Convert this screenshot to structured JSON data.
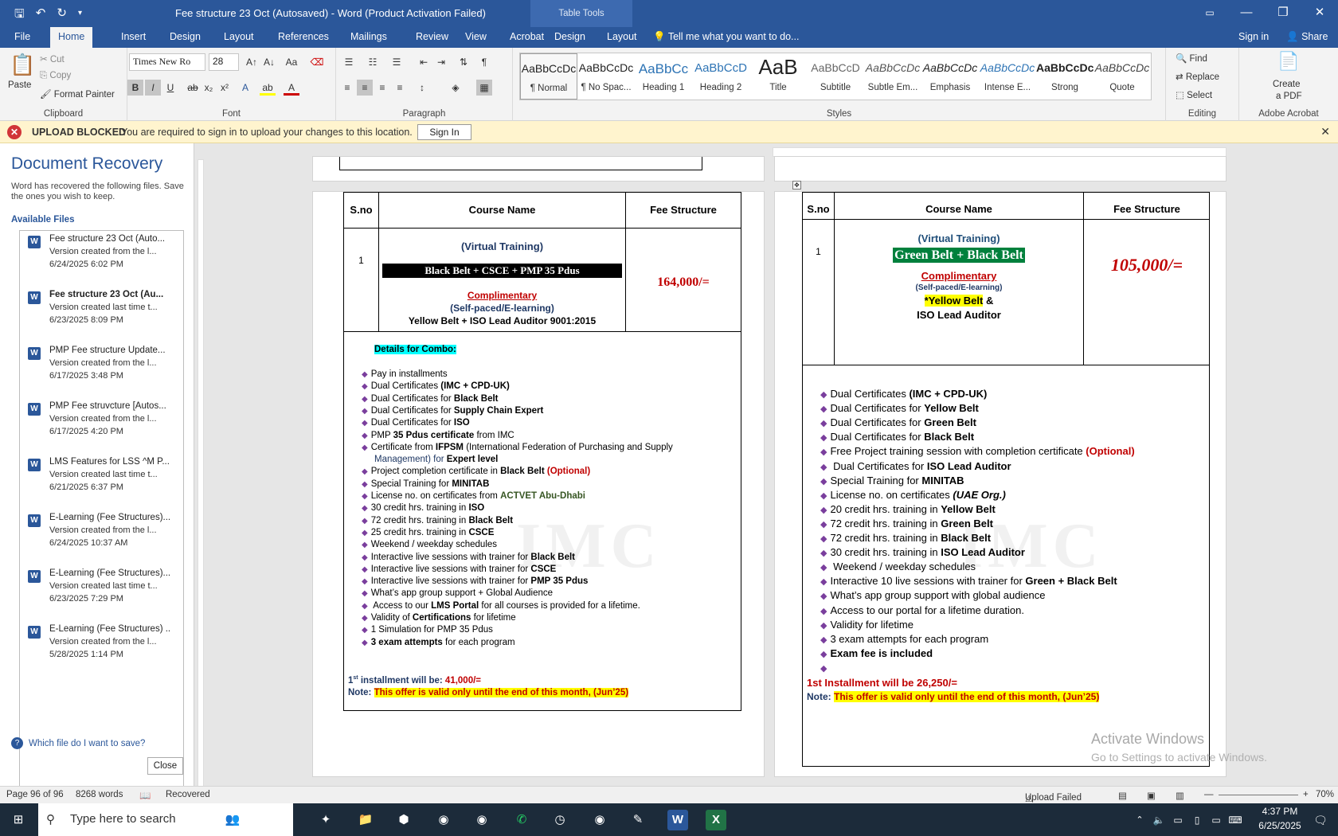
{
  "window": {
    "title": "Fee structure 23 Oct (Autosaved) - Word (Product Activation Failed)",
    "contextual_tab": "Table Tools"
  },
  "tabs": [
    "File",
    "Home",
    "Insert",
    "Design",
    "Layout",
    "References",
    "Mailings",
    "Review",
    "View",
    "Acrobat",
    "Design",
    "Layout"
  ],
  "tell_me": "Tell me what you want to do...",
  "sign_in": "Sign in",
  "share": "Share",
  "ribbon": {
    "clipboard": {
      "paste": "Paste",
      "cut": "Cut",
      "copy": "Copy",
      "format_painter": "Format Painter",
      "label": "Clipboard"
    },
    "font": {
      "name": "Times New Ro",
      "size": "28",
      "label": "Font"
    },
    "paragraph": {
      "label": "Paragraph"
    },
    "styles": {
      "label": "Styles",
      "items": [
        {
          "preview": "AaBbCcDc",
          "name": "¶ Normal"
        },
        {
          "preview": "AaBbCcDc",
          "name": "¶ No Spac..."
        },
        {
          "preview": "AaBbCc",
          "name": "Heading 1"
        },
        {
          "preview": "AaBbCcD",
          "name": "Heading 2"
        },
        {
          "preview": "AaB",
          "name": "Title"
        },
        {
          "preview": "AaBbCcD",
          "name": "Subtitle"
        },
        {
          "preview": "AaBbCcDc",
          "name": "Subtle Em..."
        },
        {
          "preview": "AaBbCcDc",
          "name": "Emphasis"
        },
        {
          "preview": "AaBbCcDc",
          "name": "Intense E..."
        },
        {
          "preview": "AaBbCcDc",
          "name": "Strong"
        },
        {
          "preview": "AaBbCcDc",
          "name": "Quote"
        }
      ]
    },
    "editing": {
      "find": "Find",
      "replace": "Replace",
      "select": "Select",
      "label": "Editing"
    },
    "acrobat": {
      "create": "Create",
      "pdf": "a PDF",
      "label": "Adobe Acrobat"
    }
  },
  "message_bar": {
    "title": "UPLOAD BLOCKED",
    "text": "You are required to sign in to upload your changes to this location.",
    "button": "Sign In"
  },
  "recovery": {
    "heading": "Document Recovery",
    "desc": "Word has recovered the following files. Save the ones you wish to keep.",
    "available": "Available Files",
    "files": [
      {
        "name": "Fee structure 23 Oct (Auto...",
        "version": "Version created from the l...",
        "date": "6/24/2025 6:02 PM"
      },
      {
        "name": "Fee structure 23 Oct (Au...",
        "version": "Version created last time t...",
        "date": "6/23/2025 8:09 PM"
      },
      {
        "name": "PMP Fee structure Update...",
        "version": "Version created from the l...",
        "date": "6/17/2025 3:48 PM"
      },
      {
        "name": "PMP Fee struvcture  [Autos...",
        "version": "Version created from the l...",
        "date": "6/17/2025 4:20 PM"
      },
      {
        "name": "LMS Features for LSS ^M P...",
        "version": "Version created last time t...",
        "date": "6/21/2025 6:37 PM"
      },
      {
        "name": "E-Learning (Fee Structures)...",
        "version": "Version created from the l...",
        "date": "6/24/2025 10:37 AM"
      },
      {
        "name": "E-Learning (Fee Structures)...",
        "version": "Version created last time t...",
        "date": "6/23/2025 7:29 PM"
      },
      {
        "name": "E-Learning (Fee Structures) ..",
        "version": "Version created from the l...",
        "date": "5/28/2025 1:14 PM"
      }
    ],
    "which": "Which file do I want to save?",
    "close": "Close"
  },
  "left_page": {
    "headers": [
      "S.no",
      "Course Name",
      "Fee Structure"
    ],
    "sno": "1",
    "virtual": "(Virtual Training)",
    "course": "Black Belt + CSCE + PMP 35 Pdus",
    "compl": "Complimentary",
    "selfpaced": "(Self-paced/E-learning)",
    "extra": "Yellow Belt + ISO Lead Auditor 9001:2015",
    "fee": "164,000/=",
    "details": "Details for Combo:",
    "bullets": [
      [
        "Pay in installments"
      ],
      [
        "Dual Certificates ",
        "(IMC + CPD-UK)"
      ],
      [
        "Dual Certificates for ",
        "Black Belt"
      ],
      [
        "Dual Certificates for ",
        "Supply Chain Expert"
      ],
      [
        "Dual Certificates for ",
        "ISO"
      ],
      [
        "PMP ",
        "35 Pdus certificate",
        " from IMC"
      ],
      [
        "Certificate from ",
        "IFPSM",
        " (International Federation of Purchasing and Supply"
      ],
      [
        "Management) for ",
        "Expert level"
      ],
      [
        "Project completion certificate in ",
        "Black Belt",
        " (Optional)"
      ],
      [
        "Special Training for ",
        "MINITAB"
      ],
      [
        "License no. on certificates from ",
        "ACTVET Abu-Dhabi"
      ],
      [
        "30 credit hrs. training in ",
        "ISO"
      ],
      [
        "72 credit hrs. training in ",
        "Black Belt"
      ],
      [
        "25 credit hrs. training in ",
        "CSCE"
      ],
      [
        "Weekend / weekday schedules"
      ],
      [
        "Interactive live sessions with trainer for ",
        "Black Belt"
      ],
      [
        "Interactive live sessions with trainer for ",
        "CSCE"
      ],
      [
        "Interactive live sessions with trainer for ",
        "PMP 35 Pdus"
      ],
      [
        "What’s app group support + Global Audience"
      ],
      [
        " Access to our ",
        "LMS Portal",
        " for all courses is provided for a lifetime."
      ],
      [
        "Validity of ",
        "Certifications",
        " for lifetime"
      ],
      [
        "1 Simulation for PMP 35 Pdus"
      ],
      [
        "",
        "3 exam attempts",
        " for each program"
      ]
    ],
    "installment_pre": "1",
    "installment_sup": "st",
    "installment_text": " installment will be: ",
    "installment_amt": "41,000/=",
    "note_label": "Note: ",
    "note_text": "This offer is valid only until the end of this month, (Jun’25)",
    "watermark": "IMC"
  },
  "right_page": {
    "headers": [
      "S.no",
      "Course Name",
      "Fee Structure"
    ],
    "sno": "1",
    "virtual": "(Virtual Training)",
    "course": "Green Belt + Black Belt",
    "compl": "Complimentary",
    "selfpaced": "(Self-paced/E-learning)",
    "yellow": "*Yellow Belt",
    "amp": " &",
    "iso": "ISO Lead Auditor",
    "fee": "105,000/=",
    "bullets": [
      [
        "Dual Certificates ",
        "(IMC + CPD-UK)"
      ],
      [
        "Dual Certificates for ",
        "Yellow Belt"
      ],
      [
        "Dual Certificates for ",
        "Green Belt"
      ],
      [
        "Dual Certificates for ",
        "Black Belt"
      ],
      [
        "Free Project training session with completion certificate ",
        "(Optional)"
      ],
      [
        " Dual Certificates for ",
        "ISO Lead Auditor"
      ],
      [
        "Special Training for ",
        "MINITAB"
      ],
      [
        "License no. on certificates ",
        "(UAE Org.)"
      ],
      [
        "20 credit hrs. training in ",
        "Yellow Belt"
      ],
      [
        "72 credit hrs. training in ",
        "Green Belt"
      ],
      [
        "72 credit hrs. training in ",
        "Black Belt"
      ],
      [
        "30 credit hrs. training in  ",
        "ISO Lead Auditor"
      ],
      [
        " Weekend / weekday schedules"
      ],
      [
        "Interactive 10 live sessions with trainer for ",
        "Green + Black Belt"
      ],
      [
        "What’s app group support with global audience"
      ],
      [
        "Access to our portal for a lifetime duration."
      ],
      [
        "Validity for lifetime"
      ],
      [
        "3 exam attempts for each program"
      ],
      [
        "",
        "Exam fee is included"
      ],
      [
        ""
      ]
    ],
    "installment": "1st Installment will be 26,250/=",
    "note_label": "Note: ",
    "note_text": "This offer is valid only until the end of this month, (Jun’25)",
    "watermark": "IMC"
  },
  "activate": {
    "line1": "Activate Windows",
    "line2": "Go to Settings to activate Windows."
  },
  "statusbar": {
    "page": "Page 96 of 96",
    "words": "8268 words",
    "recovered": "Recovered",
    "upload": "Upload Failed",
    "zoom": "70%"
  },
  "taskbar": {
    "search": "Type here to search",
    "time": "4:37 PM",
    "date": "6/25/2025"
  },
  "colors": {
    "word_blue": "#2b579a",
    "fee_red": "#c00000",
    "green_hl": "#00803c",
    "yellow_hl": "#ffff00",
    "cyan_hl": "#00ffff"
  }
}
